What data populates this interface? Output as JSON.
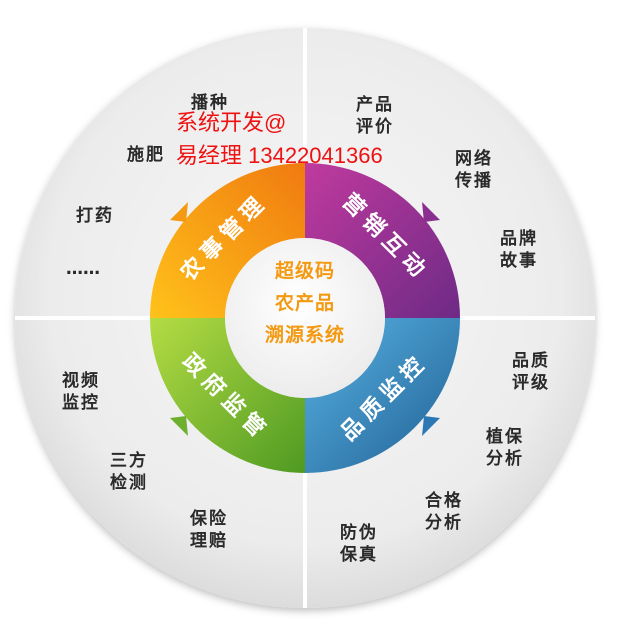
{
  "center": {
    "line1": "超级码",
    "line2": "农产品",
    "line3": "溯源系统"
  },
  "segments": [
    {
      "id": "nongshi",
      "label": "农事管理",
      "color_light": "#ffc21a",
      "color_dark": "#f07a10"
    },
    {
      "id": "yingxiao",
      "label": "营销互动",
      "color_light": "#c03a9e",
      "color_dark": "#6e2a86"
    },
    {
      "id": "pinzhi",
      "label": "品质监控",
      "color_light": "#4aa3d8",
      "color_dark": "#1f5f93"
    },
    {
      "id": "zhengfu",
      "label": "政府监管",
      "color_light": "#a8d43a",
      "color_dark": "#4f9a22"
    }
  ],
  "outer_labels": {
    "bozhong": [
      "播种"
    ],
    "shifei": [
      "施肥"
    ],
    "dayao": [
      "打药"
    ],
    "ellipsis": [
      "……"
    ],
    "chanpin": [
      "产品",
      "评价"
    ],
    "wangluo": [
      "网络",
      "传播"
    ],
    "pinpai": [
      "品牌",
      "故事"
    ],
    "pinzhi_pj": [
      "品质",
      "评级"
    ],
    "zhibao": [
      "植保",
      "分析"
    ],
    "hege": [
      "合格",
      "分析"
    ],
    "fangwei": [
      "防伪",
      "保真"
    ],
    "baoxian": [
      "保险",
      "理赔"
    ],
    "sanfang": [
      "三方",
      "检测"
    ],
    "shipin": [
      "视频",
      "监控"
    ]
  },
  "watermark": {
    "line1": "系统开发@",
    "line2": "易经理 13422041366"
  },
  "colors": {
    "outer_disc": "#ececec",
    "divider": "#ffffff",
    "text": "#2a2a2a",
    "center_text": "#f39a12",
    "watermark": "#ee1111"
  }
}
